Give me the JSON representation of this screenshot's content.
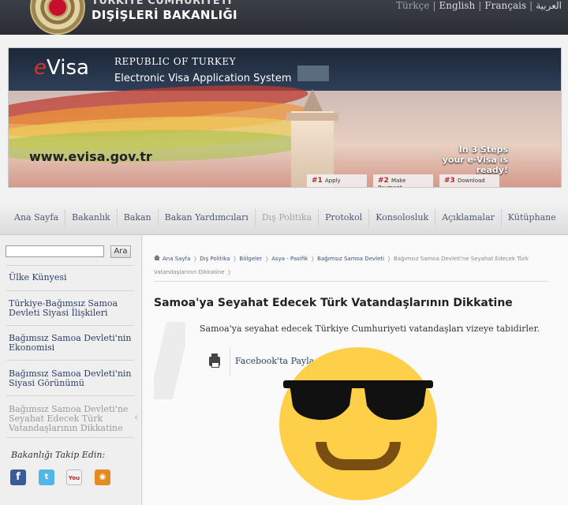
{
  "header": {
    "ministry_line1": "TÜRKİYE CUMHURİYETİ",
    "ministry_line2": "DIŞİŞLERİ BAKANLIĞI",
    "languages": [
      "Türkçe",
      "English",
      "Français",
      "العربية"
    ]
  },
  "banner": {
    "logo": "e-Visa",
    "republic": "REPUBLIC OF TURKEY",
    "system": "Electronic Visa Application System",
    "url": "www.evisa.gov.tr",
    "steps_line1": "In 3 Steps",
    "steps_line2": "your e-Visa is ready!",
    "step1": "Apply",
    "step2": "Make Payment",
    "step3": "Download"
  },
  "nav": {
    "items": [
      "Ana Sayfa",
      "Bakanlık",
      "Bakan",
      "Bakan Yardımcıları",
      "Dış Politika",
      "Protokol",
      "Konsolosluk",
      "Açıklamalar",
      "Kütüphane"
    ]
  },
  "sidebar": {
    "search_button": "Ara",
    "items": [
      "Ülke Künyesi",
      "Türkiye-Bağımsız Samoa Devleti Siyasi İlişkileri",
      "Bağımsız Samoa Devleti'nin Ekonomisi",
      "Bağımsız Samoa Devleti'nin Siyasi Görünümü",
      "Bağımsız Samoa Devleti'ne Seyahat Edecek Türk Vatandaşlarının Dikkatine"
    ],
    "follow": "Bakanlığı Takip Edin:"
  },
  "breadcrumb": {
    "items": [
      "Ana Sayfa",
      "Dış Politika",
      "Bölgeler",
      "Asya - Pasifik",
      "Bağımsız Samoa Devleti"
    ],
    "current": "Bağımsız Samoa Devleti'ne Seyahat Edecek Türk Vatandaşlarının Dikkatine"
  },
  "content": {
    "title": "Samoa'ya Seyahat Edecek Türk Vatandaşlarının Dikkatine",
    "body": "Samoa'ya seyahat edecek Türkiye Cumhuriyeti vatandaşları vizeye tabidirler.",
    "share": "Facebook'ta Payla"
  },
  "colors": {
    "emoji": "#fed04a",
    "header": "#2a2d33",
    "link": "#2c4166"
  }
}
